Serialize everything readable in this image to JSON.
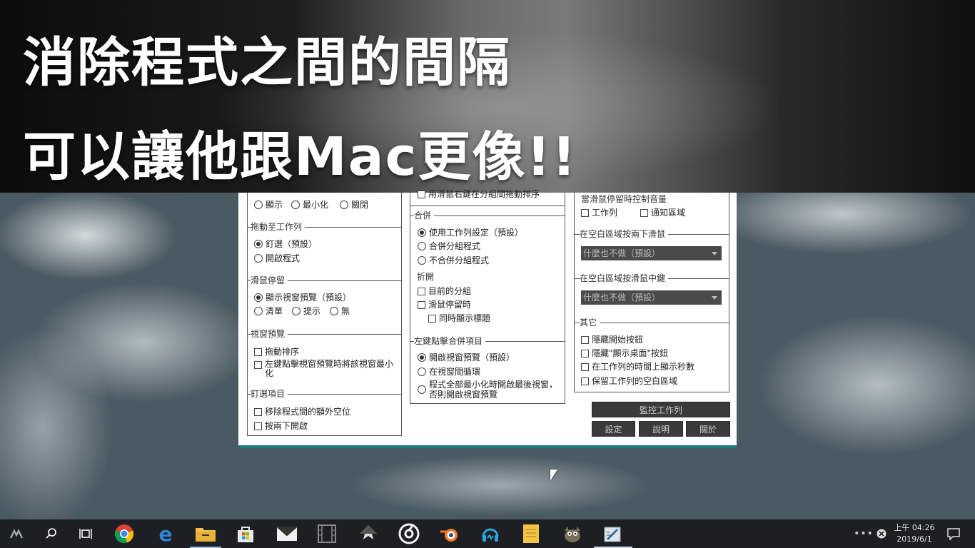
{
  "banner": {
    "line1": "消除程式之間的間隔",
    "line2": "可以讓他跟Mac更像!!"
  },
  "col1": {
    "top_options": [
      {
        "label": "顯示",
        "checked": false
      },
      {
        "label": "最小化",
        "checked": false
      },
      {
        "label": "關閉",
        "checked": false
      }
    ],
    "drag_title": "拖動至工作列",
    "drag_options": [
      {
        "label": "釘選（預設）",
        "checked": true
      },
      {
        "label": "開啟程式",
        "checked": false
      }
    ],
    "hover_title": "滑鼠停留",
    "hover_options": [
      {
        "label": "顯示視窗預覽（預設）",
        "checked": true
      },
      {
        "label": "清單",
        "checked": false
      },
      {
        "label": "提示",
        "checked": false
      },
      {
        "label": "無",
        "checked": false
      }
    ],
    "preview_title": "視窗預覽",
    "preview_options": [
      {
        "label": "拖動排序",
        "checked": false
      },
      {
        "label_line1": "左鍵點擊視窗預覽時將該視窗最小",
        "label_line2": "化",
        "checked": false
      }
    ],
    "pin_title": "釘選項目",
    "pin_options": [
      {
        "label": "移除程式間的額外空位",
        "checked": false
      },
      {
        "label": "按兩下開啟",
        "checked": false
      }
    ]
  },
  "col2": {
    "top_option": {
      "label": "用滑鼠右鍵在分組間拖動排序",
      "checked": false
    },
    "combine_title": "合併",
    "combine_options": [
      {
        "label": "使用工作列設定（預設）",
        "checked": true
      },
      {
        "label": "合併分組程式",
        "checked": false
      },
      {
        "label": "不合併分組程式",
        "checked": false
      }
    ],
    "collapse_title": "折開",
    "collapse_options": [
      {
        "label": "目前的分組",
        "checked": false
      },
      {
        "label": "滑鼠停留時",
        "checked": false
      },
      {
        "label": "同時顯示標題",
        "checked": false
      }
    ],
    "leftclick_title": "左鍵點擊合併項目",
    "leftclick_options": [
      {
        "label": "開啟視窗預覽（預設）",
        "checked": true
      },
      {
        "label": "在視窗間循環",
        "checked": false
      },
      {
        "label_line1": "程式全部最小化時開啟最後視窗，",
        "label_line2": "否則開啟視窗預覽",
        "checked": false
      }
    ]
  },
  "col3": {
    "volume_label": "當滑鼠停留時控制音量",
    "volume_options": [
      {
        "label": "工作列",
        "checked": false
      },
      {
        "label": "通知區域",
        "checked": false
      }
    ],
    "dblclick_title": "在空白區域按兩下滑鼠",
    "dblclick_value": "什麼也不做（預設）",
    "middleclick_title": "在空白區域按滑鼠中鍵",
    "middleclick_value": "什麼也不做（預設）",
    "other_title": "其它",
    "other_options": [
      {
        "label": "隱藏開始按鈕",
        "checked": false
      },
      {
        "label": "隱藏\"顯示桌面\"按鈕",
        "checked": false
      },
      {
        "label": "在工作列的時間上顯示秒數",
        "checked": false
      },
      {
        "label": "保留工作列的空白區域",
        "checked": false
      }
    ]
  },
  "buttons": {
    "monitor": "監控工作列",
    "settings": "設定",
    "help": "說明",
    "about": "關於"
  },
  "taskbar": {
    "time": "上午 04:26",
    "date": "2019/6/1",
    "apps": [
      "launcher-icon",
      "search-icon",
      "task-view-icon",
      "chrome-icon",
      "edge-icon",
      "file-explorer-icon",
      "store-icon",
      "mail-icon",
      "film-icon",
      "inkscape-icon",
      "obs-icon",
      "blender-icon",
      "headphones-app-icon",
      "notes-icon",
      "gimp-icon",
      "taskbar-tweaker-icon"
    ]
  },
  "colors": {
    "accent": "#1f7a7f",
    "button_bg": "#3a3a3a",
    "taskbar_bg": "#1e1f22"
  }
}
